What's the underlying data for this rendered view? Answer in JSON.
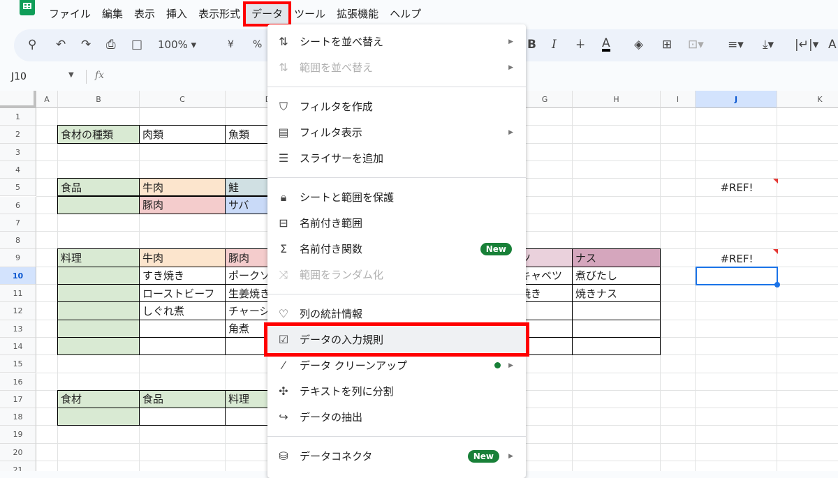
{
  "menubar": {
    "items": [
      "ファイル",
      "編集",
      "表示",
      "挿入",
      "表示形式",
      "データ",
      "ツール",
      "拡張機能",
      "ヘルプ"
    ],
    "active": "データ"
  },
  "toolbar": {
    "zoom": "100%",
    "currency": "¥",
    "percent": "%",
    "bold": "B",
    "italic": "I"
  },
  "formula_bar": {
    "name_box": "J10",
    "fx": "fx",
    "value": ""
  },
  "columns": [
    "A",
    "B",
    "C",
    "D",
    "E",
    "F",
    "G",
    "H",
    "I",
    "J",
    "K"
  ],
  "selected": {
    "column": "J",
    "row": 10
  },
  "rows": 21,
  "cells": [
    {
      "ref": "B2",
      "text": "食材の種類",
      "fill": "#d9ead3"
    },
    {
      "ref": "C2",
      "text": "肉類"
    },
    {
      "ref": "D2",
      "text": "魚類"
    },
    {
      "ref": "B5",
      "text": "食品",
      "fill": "#d9ead3"
    },
    {
      "ref": "C5",
      "text": "牛肉",
      "fill": "#fce5cd"
    },
    {
      "ref": "D5",
      "text": "鮭",
      "fill": "#d0e0e3"
    },
    {
      "ref": "B6",
      "text": "",
      "fill": "#d9ead3"
    },
    {
      "ref": "C6",
      "text": "豚肉",
      "fill": "#f4cccc"
    },
    {
      "ref": "D6",
      "text": "サバ",
      "fill": "#c9daf8"
    },
    {
      "ref": "J5",
      "text": "#REF!",
      "error": true
    },
    {
      "ref": "B9",
      "text": "料理",
      "fill": "#d9ead3"
    },
    {
      "ref": "C9",
      "text": "牛肉",
      "fill": "#fce5cd"
    },
    {
      "ref": "D9",
      "text": "豚肉",
      "fill": "#f4cccc"
    },
    {
      "ref": "G9",
      "text": "ツ",
      "fill": "#ead1dc"
    },
    {
      "ref": "H9",
      "text": "ナス",
      "fill": "#d5a6bd"
    },
    {
      "ref": "J9",
      "text": "#REF!",
      "error": true
    },
    {
      "ref": "C10",
      "text": "すき焼き"
    },
    {
      "ref": "D10",
      "text": "ポークソ"
    },
    {
      "ref": "G10",
      "text": "キャベツ"
    },
    {
      "ref": "H10",
      "text": "煮びたし"
    },
    {
      "ref": "C11",
      "text": "ローストビーフ"
    },
    {
      "ref": "D11",
      "text": "生姜焼き"
    },
    {
      "ref": "G11",
      "text": "焼き"
    },
    {
      "ref": "H11",
      "text": "焼きナス"
    },
    {
      "ref": "C12",
      "text": "しぐれ煮"
    },
    {
      "ref": "D12",
      "text": "チャーシ"
    },
    {
      "ref": "D13",
      "text": "角煮"
    },
    {
      "ref": "B17",
      "text": "食材",
      "fill": "#d9ead3"
    },
    {
      "ref": "C17",
      "text": "食品",
      "fill": "#d9ead3"
    },
    {
      "ref": "D17",
      "text": "料理",
      "fill": "#d9ead3"
    }
  ],
  "data_menu": {
    "groups": [
      [
        {
          "label": "シートを並べ替え",
          "icon": "sort-icon",
          "submenu": true
        },
        {
          "label": "範囲を並べ替え",
          "icon": "sort-range-icon",
          "submenu": true,
          "disabled": true
        }
      ],
      [
        {
          "label": "フィルタを作成",
          "icon": "filter-icon"
        },
        {
          "label": "フィルタ表示",
          "icon": "filter-view-icon",
          "submenu": true
        },
        {
          "label": "スライサーを追加",
          "icon": "slicer-icon"
        }
      ],
      [
        {
          "label": "シートと範囲を保護",
          "icon": "lock-icon"
        },
        {
          "label": "名前付き範囲",
          "icon": "named-range-icon"
        },
        {
          "label": "名前付き関数",
          "icon": "sigma-icon",
          "badge": "New"
        },
        {
          "label": "範囲をランダム化",
          "icon": "shuffle-icon",
          "disabled": true
        }
      ],
      [
        {
          "label": "列の統計情報",
          "icon": "lightbulb-icon"
        },
        {
          "label": "データの入力規則",
          "icon": "data-validation-icon",
          "highlighted": true
        },
        {
          "label": "データ クリーンアップ",
          "icon": "wand-icon",
          "submenu": true,
          "dot": true
        },
        {
          "label": "テキストを列に分割",
          "icon": "split-icon"
        },
        {
          "label": "データの抽出",
          "icon": "extract-icon"
        }
      ],
      [
        {
          "label": "データコネクタ",
          "icon": "database-icon",
          "submenu": true,
          "badge": "New"
        }
      ]
    ]
  },
  "colors": {
    "highlight_box": "#ff0000",
    "selection": "#1a73e8",
    "badge": "#188038"
  }
}
